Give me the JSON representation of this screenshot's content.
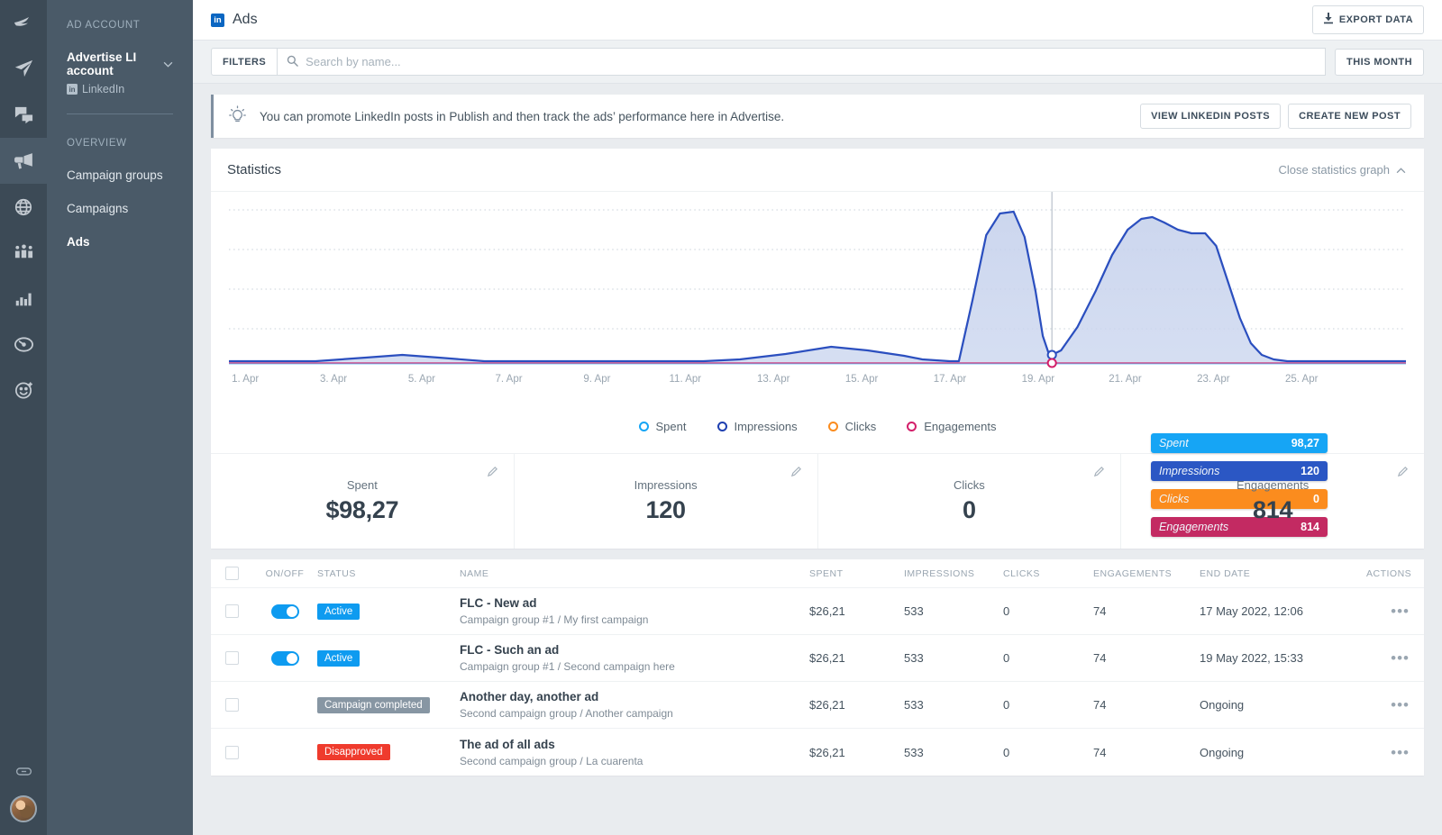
{
  "rail": {
    "icons": [
      {
        "name": "brand-feather-icon",
        "active": false
      },
      {
        "name": "publish-paperplane-icon",
        "active": false
      },
      {
        "name": "engage-chat-icon",
        "active": false
      },
      {
        "name": "advertise-megaphone-icon",
        "active": true
      },
      {
        "name": "monitor-globe-icon",
        "active": false
      },
      {
        "name": "influencers-people-icon",
        "active": false
      },
      {
        "name": "analyze-barchart-icon",
        "active": false
      },
      {
        "name": "dashboard-gauge-icon",
        "active": false
      },
      {
        "name": "audience-smiley-icon",
        "active": false
      }
    ],
    "link_icon": "link-icon",
    "avatar": "user-avatar"
  },
  "sidebar": {
    "section_label": "AD ACCOUNT",
    "account_name": "Advertise LI account",
    "account_network": "LinkedIn",
    "overview_label": "OVERVIEW",
    "items": [
      {
        "label": "Campaign groups",
        "active": false
      },
      {
        "label": "Campaigns",
        "active": false
      },
      {
        "label": "Ads",
        "active": true
      }
    ]
  },
  "topbar": {
    "logo_text": "in",
    "title": "Ads",
    "export_label": "Export data"
  },
  "filterbar": {
    "filters_label": "Filters",
    "search_placeholder": "Search by name...",
    "search_value": "",
    "period_label": "This month"
  },
  "tip": {
    "icon": "lightbulb-icon",
    "text": "You can promote LinkedIn posts in Publish and then track the ads’ performance here in Advertise.",
    "view_posts_label": "View LinkedIn posts",
    "create_post_label": "Create new post"
  },
  "statistics": {
    "title": "Statistics",
    "close_label": "Close statistics graph"
  },
  "chart_data": {
    "type": "area",
    "title": "Statistics",
    "xlabel": "",
    "ylabel": "",
    "grid": true,
    "legend_position": "bottom",
    "hover_date": "19. Apr",
    "xticks": [
      "1. Apr",
      "3. Apr",
      "5. Apr",
      "7. Apr",
      "9. Apr",
      "11. Apr",
      "13. Apr",
      "15. Apr",
      "17. Apr",
      "19. Apr",
      "21. Apr",
      "23. Apr",
      "25. Apr"
    ],
    "x": [
      1,
      2,
      3,
      4,
      5,
      6,
      7,
      8,
      9,
      10,
      11,
      12,
      13,
      14,
      15,
      16,
      17,
      18,
      19,
      20,
      21,
      22,
      23,
      24,
      25,
      26
    ],
    "series": [
      {
        "name": "Spent",
        "color": "#16a5f5",
        "values": [
          0,
          0,
          0,
          0,
          0,
          0,
          0,
          0,
          0,
          0,
          0,
          0,
          0,
          0,
          0,
          0,
          0,
          0,
          98.27,
          0,
          0,
          0,
          0,
          0,
          0,
          0
        ]
      },
      {
        "name": "Impressions",
        "color": "#2b57c4",
        "values": [
          0,
          0,
          1,
          3,
          2,
          1,
          0,
          0,
          0,
          0,
          0,
          0,
          0,
          2,
          6,
          7,
          5,
          62,
          10,
          42,
          60,
          60,
          20,
          1,
          0,
          0
        ]
      },
      {
        "name": "Clicks",
        "color": "#fb8c1e",
        "values": [
          0,
          0,
          0,
          0,
          0,
          0,
          0,
          0,
          0,
          0,
          0,
          0,
          0,
          0,
          0,
          0,
          0,
          0,
          0,
          0,
          0,
          0,
          0,
          0,
          0,
          0
        ]
      },
      {
        "name": "Engagements",
        "color": "#d31f6a",
        "values": [
          0,
          0,
          0,
          0,
          0,
          0,
          0,
          0,
          0,
          0,
          0,
          0,
          0,
          0,
          0,
          0,
          0,
          0,
          814,
          0,
          0,
          0,
          0,
          0,
          0,
          0
        ]
      }
    ],
    "tooltip": [
      {
        "label": "Spent",
        "value": "98,27",
        "color": "#16a5f5"
      },
      {
        "label": "Impressions",
        "value": "120",
        "color": "#2b57c4"
      },
      {
        "label": "Clicks",
        "value": "0",
        "color": "#fb8c1e"
      },
      {
        "label": "Engagements",
        "value": "814",
        "color": "#c32a62"
      }
    ],
    "legend": [
      {
        "label": "Spent",
        "color": "#16a5f5"
      },
      {
        "label": "Impressions",
        "color": "#1e3fb0"
      },
      {
        "label": "Clicks",
        "color": "#fb8c1e"
      },
      {
        "label": "Engagements",
        "color": "#d31f6a"
      }
    ]
  },
  "kpis": [
    {
      "label": "Spent",
      "value": "$98,27"
    },
    {
      "label": "Impressions",
      "value": "120"
    },
    {
      "label": "Clicks",
      "value": "0"
    },
    {
      "label": "Engagements",
      "value": "814"
    }
  ],
  "table": {
    "columns": {
      "onoff": "ON/OFF",
      "status": "STATUS",
      "name": "NAME",
      "spent": "SPENT",
      "impressions": "IMPRESSIONS",
      "clicks": "CLICKS",
      "engagements": "ENGAGEMENTS",
      "end_date": "END DATE",
      "actions": "ACTIONS"
    },
    "rows": [
      {
        "toggle": true,
        "toggle_on": true,
        "status": "Active",
        "status_color": "#0e9bf0",
        "name": "FLC - New ad",
        "sub": "Campaign group #1 / My first campaign",
        "spent": "$26,21",
        "impressions": "533",
        "clicks": "0",
        "engagements": "74",
        "end_date": "17 May 2022, 12:06"
      },
      {
        "toggle": true,
        "toggle_on": true,
        "status": "Active",
        "status_color": "#0e9bf0",
        "name": "FLC - Such an ad",
        "sub": "Campaign group #1 / Second campaign here",
        "spent": "$26,21",
        "impressions": "533",
        "clicks": "0",
        "engagements": "74",
        "end_date": "19 May 2022, 15:33"
      },
      {
        "toggle": false,
        "toggle_on": false,
        "status": "Campaign completed",
        "status_color": "#8796a3",
        "name": "Another day, another ad",
        "sub": "Second campaign group / Another campaign",
        "spent": "$26,21",
        "impressions": "533",
        "clicks": "0",
        "engagements": "74",
        "end_date": "Ongoing"
      },
      {
        "toggle": false,
        "toggle_on": false,
        "status": "Disapproved",
        "status_color": "#ef3b2d",
        "name": "The ad of all ads",
        "sub": "Second campaign group / La cuarenta",
        "spent": "$26,21",
        "impressions": "533",
        "clicks": "0",
        "engagements": "74",
        "end_date": "Ongoing"
      }
    ]
  }
}
